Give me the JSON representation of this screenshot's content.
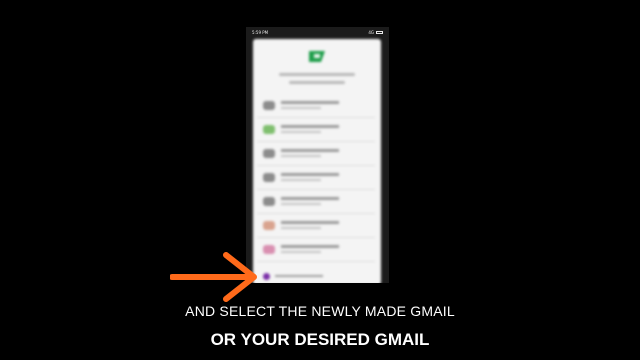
{
  "status_bar": {
    "time": "5:59 PM",
    "network": "4G"
  },
  "captions": {
    "line1": "AND SELECT THE NEWLY MADE GMAIL",
    "line2": "OR YOUR DESIRED GMAIL"
  },
  "colors": {
    "background": "#000000",
    "arrow": "#ff6a1a",
    "play_logo": "#1e9e4a",
    "selected_avatar": "#7b2fa8"
  },
  "account_list": {
    "avatar_colors": [
      "#8c8c8c",
      "#7fbf6e",
      "#8c8c8c",
      "#8c8c8c",
      "#8c8c8c",
      "#d9a38e",
      "#d98fb0"
    ]
  }
}
